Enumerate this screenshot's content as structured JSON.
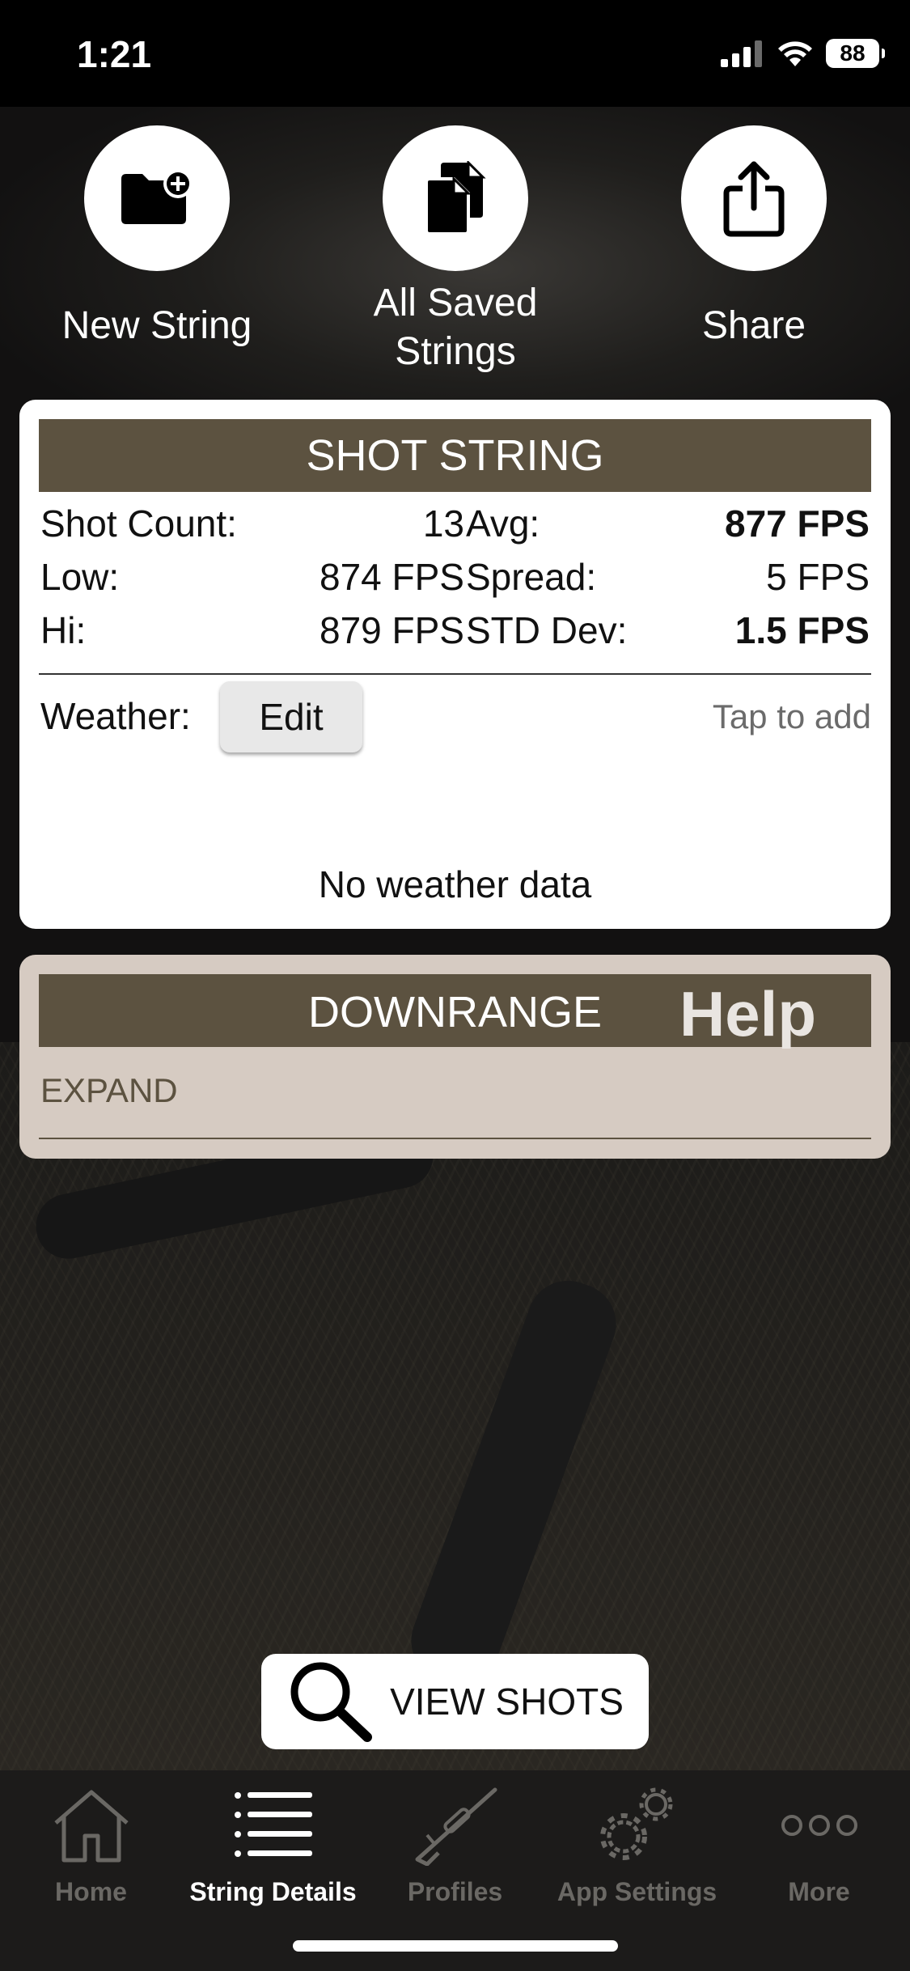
{
  "status_bar": {
    "time": "1:21",
    "battery": "88"
  },
  "actions": [
    {
      "label": "New String",
      "icon": "folder-plus-icon"
    },
    {
      "label_line1": "All Saved",
      "label_line2": "Strings",
      "icon": "documents-icon"
    },
    {
      "label": "Share",
      "icon": "share-icon"
    }
  ],
  "shot_string": {
    "title": "SHOT STRING",
    "shot_count_label": "Shot Count:",
    "shot_count": "13",
    "avg_label": "Avg:",
    "avg": "877 FPS",
    "low_label": "Low:",
    "low": "874 FPS",
    "spread_label": "Spread:",
    "spread": "5 FPS",
    "hi_label": "Hi:",
    "hi": "879 FPS",
    "std_label": "STD Dev:",
    "std": "1.5 FPS",
    "weather_label": "Weather:",
    "edit_label": "Edit",
    "tap_to_add": "Tap to add",
    "no_weather": "No weather data"
  },
  "downrange": {
    "title": "DOWNRANGE",
    "help": "Help",
    "expand": "EXPAND"
  },
  "view_shots": {
    "label": "VIEW SHOTS",
    "icon": "search-icon"
  },
  "tabs": [
    {
      "label": "Home",
      "icon": "home-icon",
      "active": false
    },
    {
      "label": "String Details",
      "icon": "list-icon",
      "active": true
    },
    {
      "label": "Profiles",
      "icon": "rifle-icon",
      "active": false
    },
    {
      "label": "App Settings",
      "icon": "gears-icon",
      "active": false
    },
    {
      "label": "More",
      "icon": "more-icon",
      "active": false
    }
  ],
  "colors": {
    "header_brown": "#5c5240",
    "downrange_bg": "#d6cbc2",
    "tabbar_bg": "#1c1b1a"
  }
}
